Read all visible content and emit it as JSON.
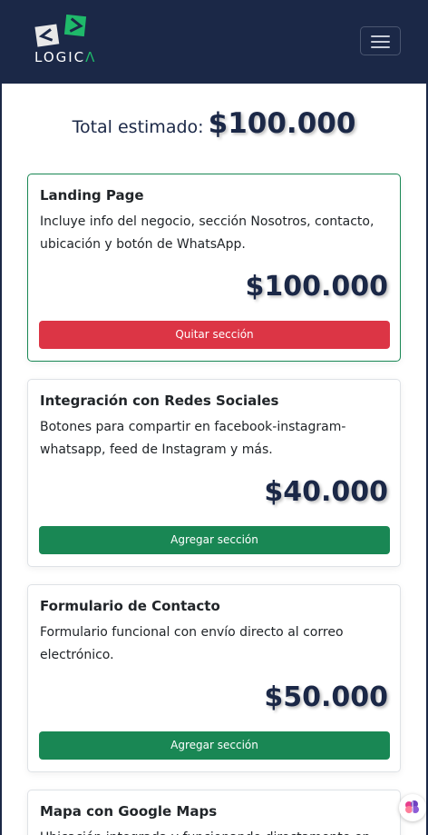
{
  "brand": {
    "name_main": "LOGIC",
    "name_accent": "Λ"
  },
  "total": {
    "label": "Total estimado:",
    "amount": "$100.000"
  },
  "cards": [
    {
      "title": "Landing Page",
      "description": "Incluye info del negocio, sección Nosotros, contacto, ubicación y botón de WhatsApp.",
      "price": "$100.000",
      "button": "Quitar sección"
    },
    {
      "title": "Integración con Redes Sociales",
      "description": "Botones para compartir en facebook-instagram-whatsapp, feed de Instagram y más.",
      "price": "$40.000",
      "button": "Agregar sección"
    },
    {
      "title": "Formulario de Contacto",
      "description": "Formulario funcional con envío directo al correo electrónico.",
      "price": "$50.000",
      "button": "Agregar sección"
    },
    {
      "title": "Mapa con Google Maps",
      "description": "Ubicación integrada y funcionando directamente en",
      "price": "",
      "button": ""
    }
  ],
  "colors": {
    "navbar": "#1b2847",
    "accent_green": "#1fb96a",
    "remove_button": "#dc3545",
    "add_button": "#198754"
  },
  "icons": {
    "menu": "hamburger-menu-icon",
    "assistant": "brain-icon"
  }
}
